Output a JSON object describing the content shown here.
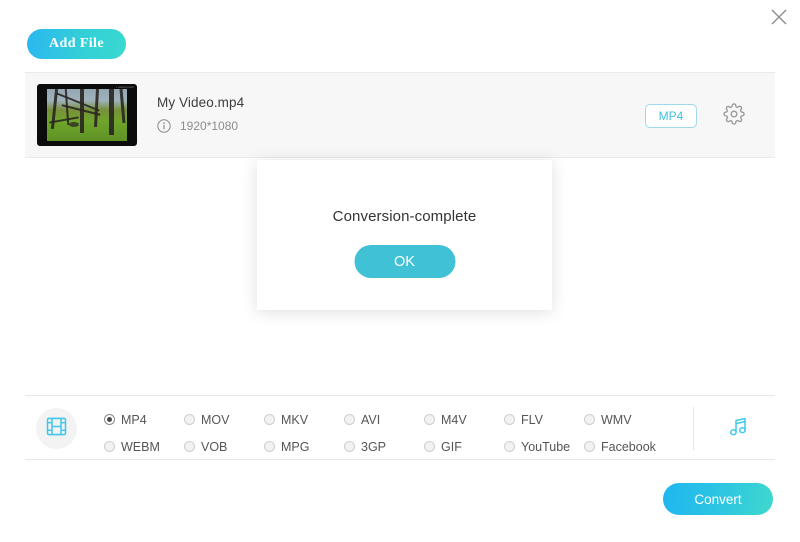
{
  "window": {
    "close_icon": "close-icon"
  },
  "toolbar": {
    "add_file_label": "Add File"
  },
  "file_list": {
    "items": [
      {
        "name": "My Video.mp4",
        "resolution": "1920*1080",
        "info_icon": "info-icon",
        "format_badge": "MP4",
        "settings_icon": "gear-icon"
      }
    ]
  },
  "modal": {
    "message": "Conversion-complete",
    "ok_label": "OK"
  },
  "format_bar": {
    "video_icon": "film-strip-icon",
    "audio_icon": "music-note-icon",
    "selected": "MP4",
    "options": [
      "MP4",
      "MOV",
      "MKV",
      "AVI",
      "M4V",
      "FLV",
      "WMV",
      "WEBM",
      "VOB",
      "MPG",
      "3GP",
      "GIF",
      "YouTube",
      "Facebook"
    ]
  },
  "footer": {
    "convert_label": "Convert"
  },
  "colors": {
    "accent_cyan": "#40c1d6",
    "gradient_start": "#1fb6f0",
    "gradient_end": "#3fd9cd",
    "badge_border": "#9ed9ec",
    "row_background": "#f7f7f7"
  }
}
